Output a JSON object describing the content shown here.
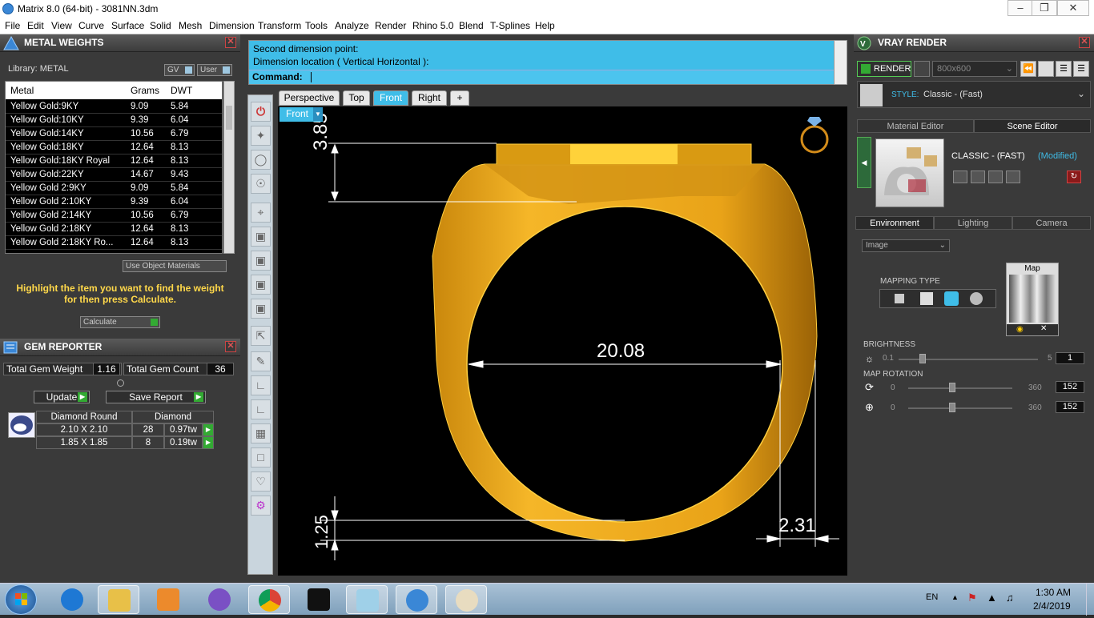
{
  "window": {
    "title": "Matrix 8.0 (64-bit) - 3081NN.3dm"
  },
  "menu": [
    "File",
    "Edit",
    "View",
    "Curve",
    "Surface",
    "Solid",
    "Mesh",
    "Dimension",
    "Transform",
    "Tools",
    "Analyze",
    "Render",
    "Rhino 5.0",
    "Blend",
    "T-Splines",
    "Help"
  ],
  "metal_weights": {
    "title": "METAL WEIGHTS",
    "library_label": "Library: METAL",
    "gv_label": "GV",
    "user_label": "User",
    "columns": [
      "Metal",
      "Grams",
      "DWT"
    ],
    "rows": [
      [
        "Yellow Gold:9KY",
        "9.09",
        "5.84"
      ],
      [
        "Yellow Gold:10KY",
        "9.39",
        "6.04"
      ],
      [
        "Yellow Gold:14KY",
        "10.56",
        "6.79"
      ],
      [
        "Yellow Gold:18KY",
        "12.64",
        "8.13"
      ],
      [
        "Yellow Gold:18KY Royal",
        "12.64",
        "8.13"
      ],
      [
        "Yellow Gold:22KY",
        "14.67",
        "9.43"
      ],
      [
        "Yellow Gold 2:9KY",
        "9.09",
        "5.84"
      ],
      [
        "Yellow Gold 2:10KY",
        "9.39",
        "6.04"
      ],
      [
        "Yellow Gold 2:14KY",
        "10.56",
        "6.79"
      ],
      [
        "Yellow Gold 2:18KY",
        "12.64",
        "8.13"
      ],
      [
        "Yellow Gold 2:18KY Ro...",
        "12.64",
        "8.13"
      ]
    ],
    "use_object_materials": "Use Object Materials",
    "hint": "Highlight the item you want to find the weight for then press Calculate.",
    "calculate": "Calculate"
  },
  "gem_reporter": {
    "title": "GEM REPORTER",
    "total_weight_label": "Total Gem Weight",
    "total_weight": "1.16",
    "total_count_label": "Total Gem Count",
    "total_count": "36",
    "update": "Update",
    "save_report": "Save Report",
    "gem_name": "Diamond Round",
    "gem_type": "Diamond",
    "rows": [
      [
        "2.10 X 2.10",
        "28",
        "0.97tw"
      ],
      [
        "1.85 X 1.85",
        "8",
        "0.19tw"
      ]
    ]
  },
  "command": {
    "line1": "Second dimension point:",
    "line2": "Dimension location ( Vertical  Horizontal ):",
    "prompt": "Command:"
  },
  "views": {
    "tabs": [
      "Perspective",
      "Top",
      "Front",
      "Right",
      "+"
    ],
    "active": "Front",
    "viewport_label": "Front"
  },
  "dimensions": {
    "top": "3.85",
    "width": "20.08",
    "bottom_left": "1.25",
    "bottom_right": "2.31"
  },
  "vray": {
    "title": "VRAY RENDER",
    "render": "RENDER",
    "resolution": "800x600",
    "style_label": "STYLE:",
    "style_value": "Classic - (Fast)",
    "tabs": [
      "Material Editor",
      "Scene Editor"
    ],
    "active_tab": "Scene Editor",
    "preset_name": "CLASSIC - (FAST)",
    "preset_status": "(Modified)",
    "env_tabs": [
      "Environment",
      "Lighting",
      "Camera"
    ],
    "env_active": "Environment",
    "env_type": "Image",
    "map_label": "Map",
    "mapping_type": "MAPPING TYPE",
    "brightness_label": "BRIGHTNESS",
    "brightness_min": "0.1",
    "brightness_max": "5",
    "brightness_value": "1",
    "brightness_level": 0.17,
    "map_rotation_label": "MAP ROTATION",
    "rot_min": "0",
    "rot_max": "360",
    "rot1": "152",
    "rot2": "152"
  },
  "taskbar": {
    "lang": "EN",
    "time": "1:30 AM",
    "date": "2/4/2019",
    "apps": [
      "start",
      "internet-explorer",
      "file-explorer",
      "media-player",
      "viber",
      "chrome",
      "game-app",
      "notepad",
      "matrix-app",
      "paint-app"
    ]
  },
  "colors": {
    "accent": "#3fbde8",
    "gold": "#f2b21f",
    "panel": "#3a3a3a"
  }
}
